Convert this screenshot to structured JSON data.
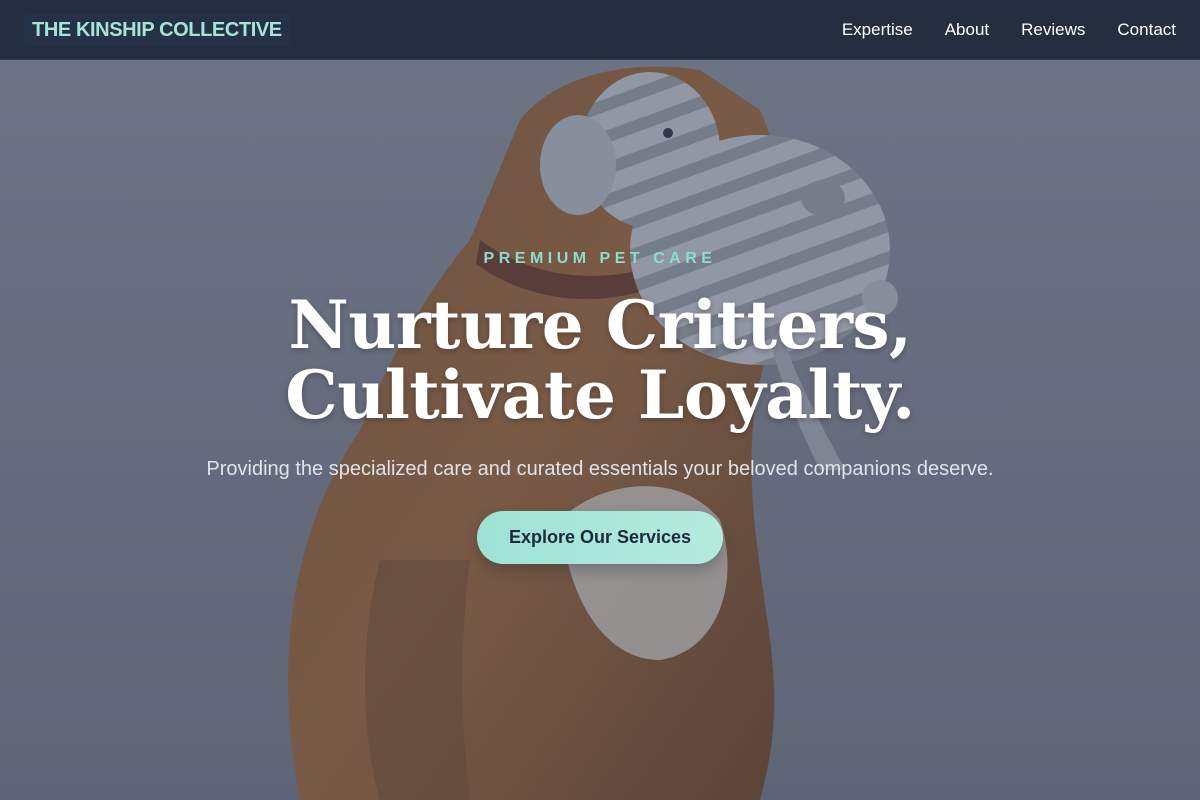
{
  "nav": {
    "brand": "THE KINSHIP COLLECTIVE",
    "links": [
      {
        "label": "Expertise"
      },
      {
        "label": "About"
      },
      {
        "label": "Reviews"
      },
      {
        "label": "Contact"
      }
    ]
  },
  "hero": {
    "eyebrow": "PREMIUM PET CARE",
    "headline_line1": "Nurture Critters,",
    "headline_line2": "Cultivate Loyalty.",
    "subtitle": "Providing the specialized care and curated essentials your beloved companions deserve.",
    "cta_label": "Explore Our Services",
    "background_image": "dog-with-plush-elephant-photo"
  },
  "colors": {
    "nav_background": "#1e293b",
    "brand_text": "#a6e3d9",
    "accent": "#8fdcc9",
    "cta_background": "#a6e3d9",
    "cta_text": "#1e293b"
  }
}
